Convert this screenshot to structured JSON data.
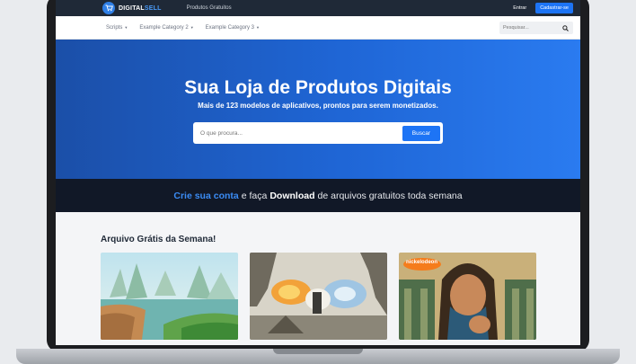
{
  "topbar": {
    "logo": "DIGITAL",
    "logo_accent": "SELL",
    "link": "Produtos Gratuitos",
    "login": "Entrar",
    "signup": "Cadastrar-se"
  },
  "categories": [
    {
      "label": "Scripts"
    },
    {
      "label": "Example Category 2"
    },
    {
      "label": "Example Category 3"
    }
  ],
  "search_mini": {
    "placeholder": "Pesquisar..."
  },
  "hero": {
    "title": "Sua Loja de Produtos Digitais",
    "subtitle": "Mais de 123 modelos de aplicativos, prontos para serem monetizados.",
    "search_placeholder": "O que procura...",
    "search_button": "Buscar"
  },
  "strip": {
    "link": "Crie sua conta",
    "text1": "e faça",
    "bold": "Download",
    "text2": "de arquivos gratuitos toda semana"
  },
  "section": {
    "title": "Arquivo Grátis da Semana!"
  },
  "thumbs": [
    {
      "badge": ""
    },
    {
      "badge": ""
    },
    {
      "badge": "nickelodeon"
    }
  ],
  "colors": {
    "primary": "#1d74f5",
    "hero_start": "#1b4fa8",
    "hero_end": "#2a7bf0",
    "dark": "#111827"
  },
  "icons": {
    "cart": "cart-icon",
    "search": "search-icon",
    "caret": "caret-down-icon"
  }
}
